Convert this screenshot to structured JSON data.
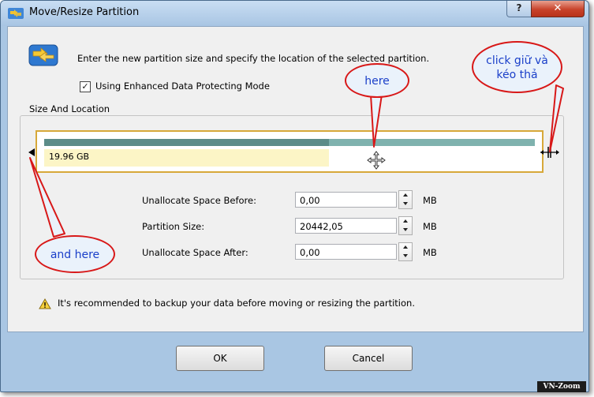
{
  "window": {
    "title": "Move/Resize Partition",
    "help_label": "?",
    "close_label": "✕"
  },
  "header": {
    "description": "Enter the new partition size and specify the location of the selected partition."
  },
  "option": {
    "checked": true,
    "label": "Using Enhanced Data Protecting Mode"
  },
  "size_location": {
    "group_title": "Size And Location",
    "partition_label": "19.96 GB"
  },
  "fields": {
    "before_label": "Unallocate Space Before:",
    "before_value": "0,00",
    "size_label": "Partition Size:",
    "size_value": "20442,05",
    "after_label": "Unallocate Space After:",
    "after_value": "0,00",
    "unit": "MB"
  },
  "warning": {
    "text": "It's recommended to backup your data before moving or resizing the partition."
  },
  "buttons": {
    "ok": "OK",
    "cancel": "Cancel"
  },
  "annotations": {
    "here": "here",
    "and_here": "and here",
    "click_drag": "click giữ và kéo thả"
  },
  "watermark": "VN-Zoom",
  "colors": {
    "titlebar": "#a9c6e3",
    "close_button": "#c8432b",
    "partition_border": "#d7a839",
    "used_fill": "#fcf5c6",
    "callout_border": "#d81818",
    "callout_text": "#1a3fc9"
  }
}
